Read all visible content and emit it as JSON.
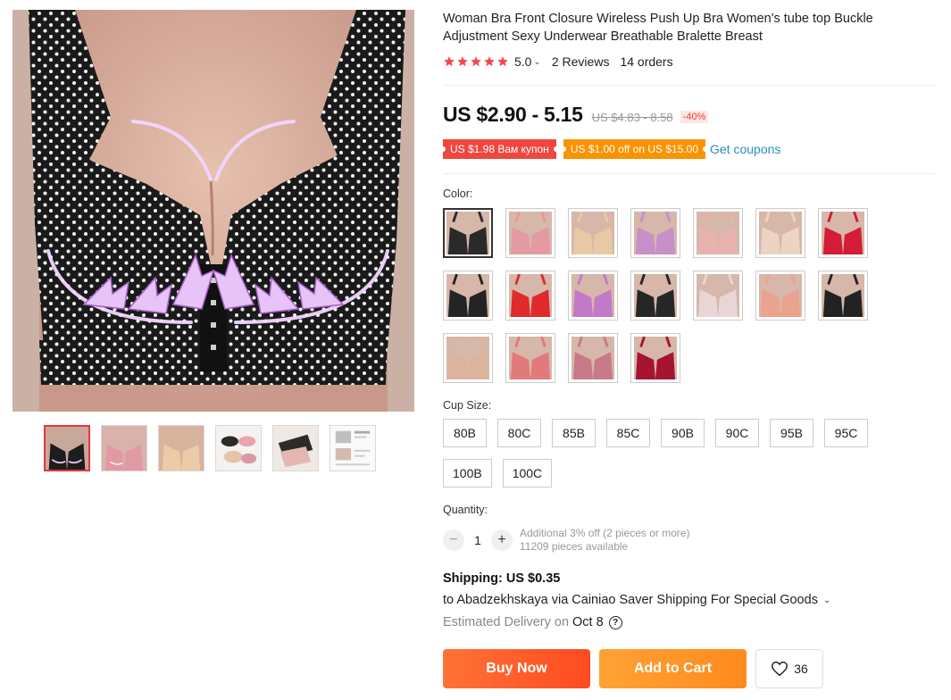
{
  "product": {
    "title": "Woman Bra Front Closure Wireless Push Up Bra Women's tube top Buckle Adjustment Sexy Underwear Breathable Bralette Breast",
    "rating": "5.0",
    "reviews": "2 Reviews",
    "orders": "14 orders",
    "price": "US $2.90 - 5.15",
    "old_price": "US $4.83 - 8.58",
    "discount": "-40%"
  },
  "coupons": {
    "items": [
      "US $1.98 Вам купон",
      "US $1.00 off on US $15.00"
    ],
    "get_label": "Get coupons"
  },
  "color": {
    "label": "Color:",
    "swatches": [
      {
        "name": "black",
        "color": "#2a2a2a"
      },
      {
        "name": "pink",
        "color": "#e39aa2"
      },
      {
        "name": "nude",
        "color": "#e9c9a4"
      },
      {
        "name": "purple",
        "color": "#c88fc9"
      },
      {
        "name": "light-pink",
        "color": "#e7b2b0"
      },
      {
        "name": "beige",
        "color": "#ecd3c2"
      },
      {
        "name": "red",
        "color": "#d41c34"
      },
      {
        "name": "black-2",
        "color": "#242424"
      },
      {
        "name": "red-2",
        "color": "#e02a2c"
      },
      {
        "name": "violet",
        "color": "#c27ac8"
      },
      {
        "name": "black-3",
        "color": "#262626"
      },
      {
        "name": "white-pink",
        "color": "#e8d6d7"
      },
      {
        "name": "salmon",
        "color": "#eba28f"
      },
      {
        "name": "black-4",
        "color": "#222222"
      },
      {
        "name": "skin",
        "color": "#dcb39c"
      },
      {
        "name": "coral",
        "color": "#e07a7d"
      },
      {
        "name": "rose",
        "color": "#c87a8a"
      },
      {
        "name": "wine",
        "color": "#a61432"
      }
    ]
  },
  "cup_size": {
    "label": "Cup Size:",
    "options": [
      "80B",
      "80C",
      "85B",
      "85C",
      "90B",
      "90C",
      "95B",
      "95C",
      "100B",
      "100C"
    ]
  },
  "quantity": {
    "label": "Quantity:",
    "value": "1",
    "minus": "−",
    "plus": "+",
    "note": "Additional 3% off (2 pieces or more)",
    "available": "11209 pieces available"
  },
  "shipping": {
    "title": "Shipping: US $0.35",
    "line": "to Abadzekhskaya via Cainiao Saver Shipping For Special Goods",
    "delivery_label": "Estimated Delivery on",
    "delivery_date": "Oct 8",
    "help": "?"
  },
  "actions": {
    "buy_now": "Buy Now",
    "add_to_cart": "Add to Cart",
    "wishlist_count": "36"
  },
  "gallery": {
    "thumbnails": [
      "black-polka-dot",
      "pink",
      "nude",
      "set-multi",
      "set-black-pink",
      "info-sheet"
    ]
  },
  "colors": {
    "accent": "#ff4b22",
    "star": "#f5484e",
    "link": "#2a8fbd"
  }
}
